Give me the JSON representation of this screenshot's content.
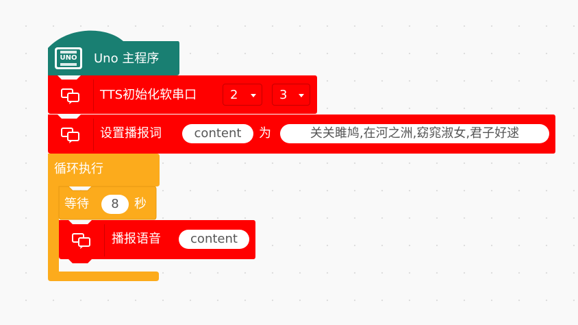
{
  "hat": {
    "label": "Uno 主程序",
    "badge": "UNO",
    "color": "#197f72"
  },
  "tts_init": {
    "label": "TTS初始化软串口",
    "rx": "2",
    "tx": "3",
    "color": "#ff0000"
  },
  "set_text": {
    "label": "设置播报词",
    "var": "content",
    "as": "为",
    "text": "关关雎鸠,在河之洲,窈窕淑女,君子好逑"
  },
  "loop": {
    "label": "循环执行",
    "color": "#fcab1c"
  },
  "wait": {
    "label": "等待",
    "value": "8",
    "unit": "秒"
  },
  "speak": {
    "label": "播报语音",
    "var": "content"
  }
}
